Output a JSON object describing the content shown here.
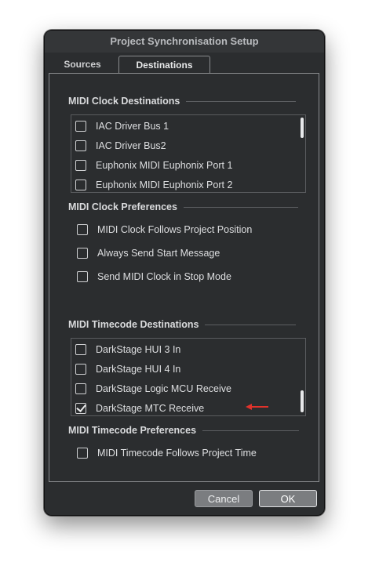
{
  "window": {
    "title": "Project Synchronisation Setup"
  },
  "tabs": [
    {
      "label": "Sources",
      "active": false
    },
    {
      "label": "Destinations",
      "active": true
    }
  ],
  "midi_clock_destinations": {
    "header": "MIDI Clock Destinations",
    "items": [
      {
        "label": "IAC Driver Bus 1",
        "checked": false
      },
      {
        "label": "IAC Driver Bus2",
        "checked": false
      },
      {
        "label": "Euphonix MIDI Euphonix Port 1",
        "checked": false
      },
      {
        "label": "Euphonix MIDI Euphonix Port 2",
        "checked": false
      }
    ]
  },
  "midi_clock_preferences": {
    "header": "MIDI Clock Preferences",
    "items": [
      {
        "label": "MIDI Clock Follows Project Position",
        "checked": false
      },
      {
        "label": "Always Send Start Message",
        "checked": false
      },
      {
        "label": "Send MIDI Clock in Stop Mode",
        "checked": false
      }
    ]
  },
  "midi_timecode_destinations": {
    "header": "MIDI Timecode Destinations",
    "items": [
      {
        "label": "DarkStage HUI 3 In",
        "checked": false
      },
      {
        "label": "DarkStage HUI 4 In",
        "checked": false
      },
      {
        "label": "DarkStage Logic MCU Receive",
        "checked": false
      },
      {
        "label": "DarkStage MTC Receive",
        "checked": true
      }
    ]
  },
  "midi_timecode_preferences": {
    "header": "MIDI Timecode Preferences",
    "items": [
      {
        "label": "MIDI Timecode Follows Project Time",
        "checked": false
      }
    ]
  },
  "buttons": {
    "cancel": "Cancel",
    "ok": "OK"
  },
  "colors": {
    "annotation_arrow": "#e0322b",
    "background": "#2b2d2f"
  }
}
